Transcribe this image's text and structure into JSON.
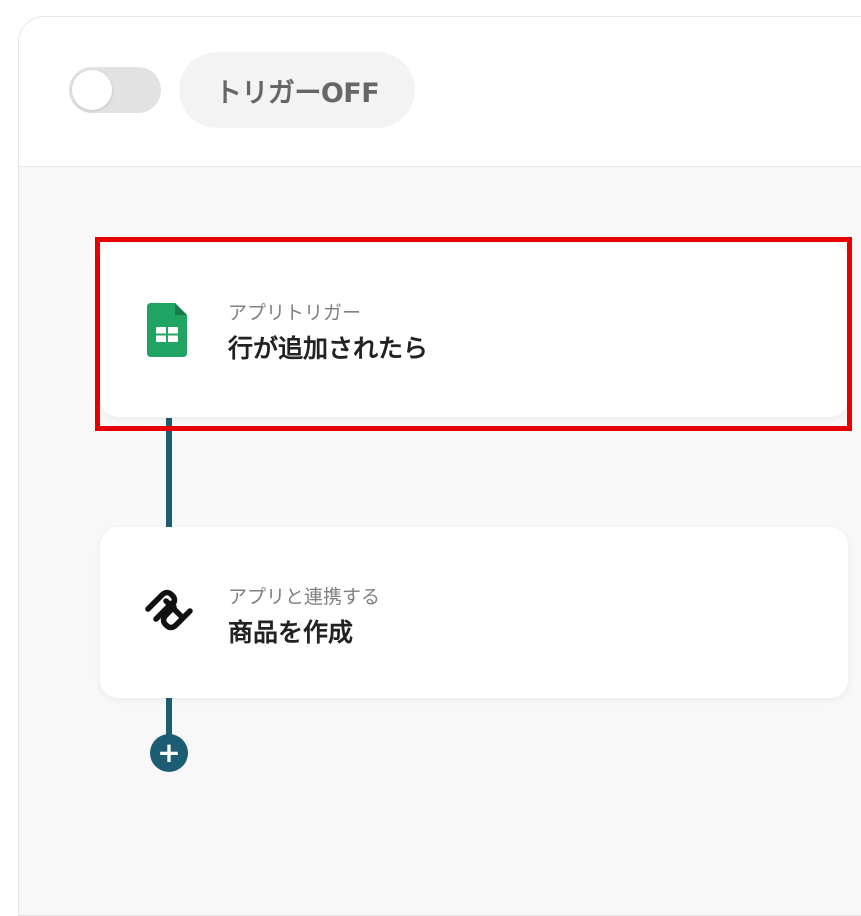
{
  "header": {
    "trigger_toggle_state": "off",
    "trigger_label": "トリガーOFF"
  },
  "steps": [
    {
      "subtitle": "アプリトリガー",
      "title": "行が追加されたら",
      "icon": "google-sheets-icon",
      "icon_color": "#1fa463",
      "highlighted": true
    },
    {
      "subtitle": "アプリと連携する",
      "title": "商品を作成",
      "icon": "squarespace-icon",
      "icon_color": "#111111",
      "highlighted": false
    }
  ],
  "colors": {
    "connector": "#1d5d73",
    "highlight": "#e60000",
    "canvas": "#f8f8f8"
  },
  "add_step_icon": "plus-icon"
}
